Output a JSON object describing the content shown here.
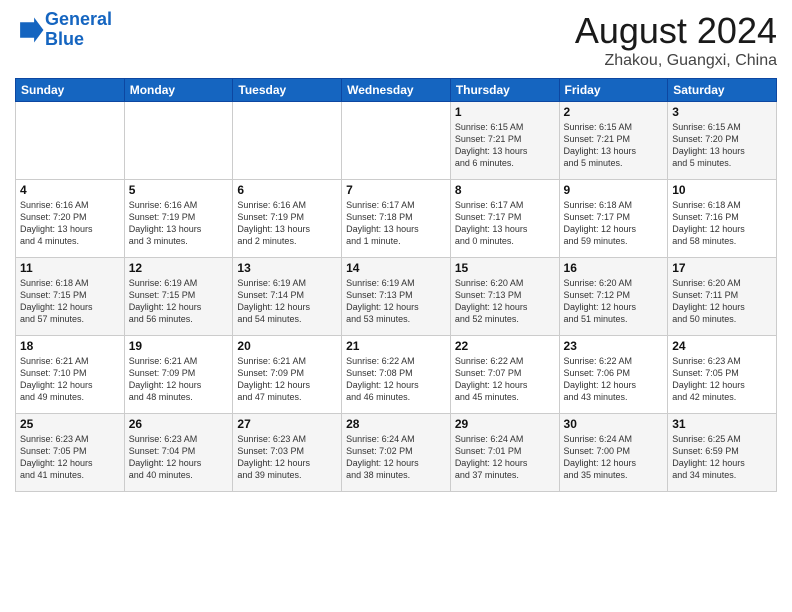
{
  "logo": {
    "line1": "General",
    "line2": "Blue"
  },
  "title": "August 2024",
  "location": "Zhakou, Guangxi, China",
  "days_of_week": [
    "Sunday",
    "Monday",
    "Tuesday",
    "Wednesday",
    "Thursday",
    "Friday",
    "Saturday"
  ],
  "weeks": [
    [
      {
        "day": "",
        "info": ""
      },
      {
        "day": "",
        "info": ""
      },
      {
        "day": "",
        "info": ""
      },
      {
        "day": "",
        "info": ""
      },
      {
        "day": "1",
        "info": "Sunrise: 6:15 AM\nSunset: 7:21 PM\nDaylight: 13 hours\nand 6 minutes."
      },
      {
        "day": "2",
        "info": "Sunrise: 6:15 AM\nSunset: 7:21 PM\nDaylight: 13 hours\nand 5 minutes."
      },
      {
        "day": "3",
        "info": "Sunrise: 6:15 AM\nSunset: 7:20 PM\nDaylight: 13 hours\nand 5 minutes."
      }
    ],
    [
      {
        "day": "4",
        "info": "Sunrise: 6:16 AM\nSunset: 7:20 PM\nDaylight: 13 hours\nand 4 minutes."
      },
      {
        "day": "5",
        "info": "Sunrise: 6:16 AM\nSunset: 7:19 PM\nDaylight: 13 hours\nand 3 minutes."
      },
      {
        "day": "6",
        "info": "Sunrise: 6:16 AM\nSunset: 7:19 PM\nDaylight: 13 hours\nand 2 minutes."
      },
      {
        "day": "7",
        "info": "Sunrise: 6:17 AM\nSunset: 7:18 PM\nDaylight: 13 hours\nand 1 minute."
      },
      {
        "day": "8",
        "info": "Sunrise: 6:17 AM\nSunset: 7:17 PM\nDaylight: 13 hours\nand 0 minutes."
      },
      {
        "day": "9",
        "info": "Sunrise: 6:18 AM\nSunset: 7:17 PM\nDaylight: 12 hours\nand 59 minutes."
      },
      {
        "day": "10",
        "info": "Sunrise: 6:18 AM\nSunset: 7:16 PM\nDaylight: 12 hours\nand 58 minutes."
      }
    ],
    [
      {
        "day": "11",
        "info": "Sunrise: 6:18 AM\nSunset: 7:15 PM\nDaylight: 12 hours\nand 57 minutes."
      },
      {
        "day": "12",
        "info": "Sunrise: 6:19 AM\nSunset: 7:15 PM\nDaylight: 12 hours\nand 56 minutes."
      },
      {
        "day": "13",
        "info": "Sunrise: 6:19 AM\nSunset: 7:14 PM\nDaylight: 12 hours\nand 54 minutes."
      },
      {
        "day": "14",
        "info": "Sunrise: 6:19 AM\nSunset: 7:13 PM\nDaylight: 12 hours\nand 53 minutes."
      },
      {
        "day": "15",
        "info": "Sunrise: 6:20 AM\nSunset: 7:13 PM\nDaylight: 12 hours\nand 52 minutes."
      },
      {
        "day": "16",
        "info": "Sunrise: 6:20 AM\nSunset: 7:12 PM\nDaylight: 12 hours\nand 51 minutes."
      },
      {
        "day": "17",
        "info": "Sunrise: 6:20 AM\nSunset: 7:11 PM\nDaylight: 12 hours\nand 50 minutes."
      }
    ],
    [
      {
        "day": "18",
        "info": "Sunrise: 6:21 AM\nSunset: 7:10 PM\nDaylight: 12 hours\nand 49 minutes."
      },
      {
        "day": "19",
        "info": "Sunrise: 6:21 AM\nSunset: 7:09 PM\nDaylight: 12 hours\nand 48 minutes."
      },
      {
        "day": "20",
        "info": "Sunrise: 6:21 AM\nSunset: 7:09 PM\nDaylight: 12 hours\nand 47 minutes."
      },
      {
        "day": "21",
        "info": "Sunrise: 6:22 AM\nSunset: 7:08 PM\nDaylight: 12 hours\nand 46 minutes."
      },
      {
        "day": "22",
        "info": "Sunrise: 6:22 AM\nSunset: 7:07 PM\nDaylight: 12 hours\nand 45 minutes."
      },
      {
        "day": "23",
        "info": "Sunrise: 6:22 AM\nSunset: 7:06 PM\nDaylight: 12 hours\nand 43 minutes."
      },
      {
        "day": "24",
        "info": "Sunrise: 6:23 AM\nSunset: 7:05 PM\nDaylight: 12 hours\nand 42 minutes."
      }
    ],
    [
      {
        "day": "25",
        "info": "Sunrise: 6:23 AM\nSunset: 7:05 PM\nDaylight: 12 hours\nand 41 minutes."
      },
      {
        "day": "26",
        "info": "Sunrise: 6:23 AM\nSunset: 7:04 PM\nDaylight: 12 hours\nand 40 minutes."
      },
      {
        "day": "27",
        "info": "Sunrise: 6:23 AM\nSunset: 7:03 PM\nDaylight: 12 hours\nand 39 minutes."
      },
      {
        "day": "28",
        "info": "Sunrise: 6:24 AM\nSunset: 7:02 PM\nDaylight: 12 hours\nand 38 minutes."
      },
      {
        "day": "29",
        "info": "Sunrise: 6:24 AM\nSunset: 7:01 PM\nDaylight: 12 hours\nand 37 minutes."
      },
      {
        "day": "30",
        "info": "Sunrise: 6:24 AM\nSunset: 7:00 PM\nDaylight: 12 hours\nand 35 minutes."
      },
      {
        "day": "31",
        "info": "Sunrise: 6:25 AM\nSunset: 6:59 PM\nDaylight: 12 hours\nand 34 minutes."
      }
    ]
  ]
}
